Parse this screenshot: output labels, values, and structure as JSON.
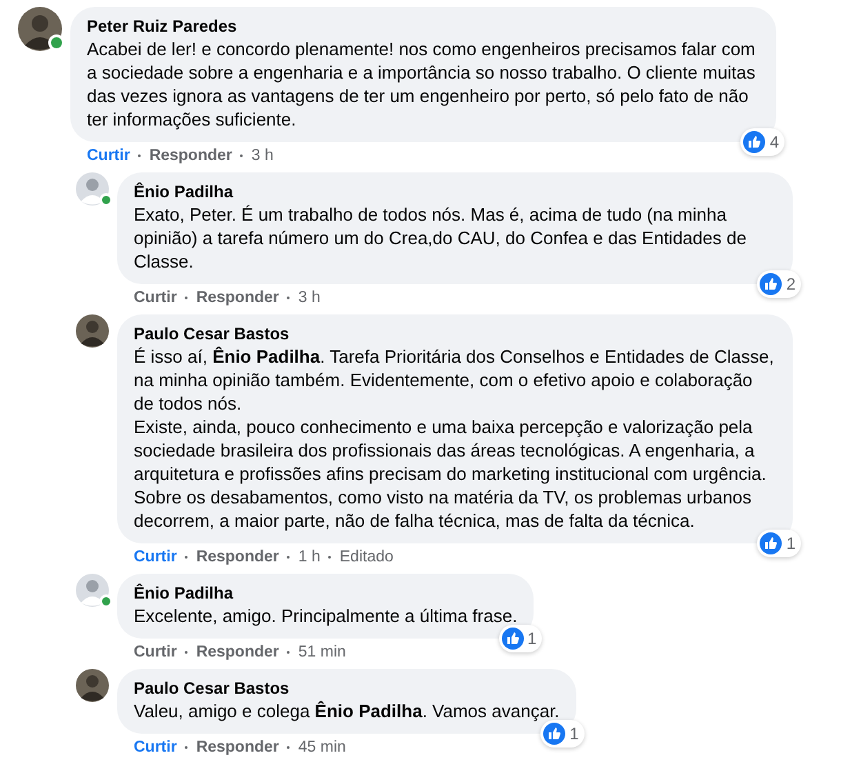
{
  "comments": [
    {
      "author": "Peter Ruiz Paredes",
      "online": true,
      "text": "Acabei de ler! e concordo plenamente! nos como engenheiros precisamos falar com a sociedade sobre a engenharia e a importância so nosso trabalho. O cliente muitas das vezes ignora as vantagens de ter um engenheiro por perto, só pelo fato de não ter informações suficiente.",
      "like_label": "Curtir",
      "liked": true,
      "reply_label": "Responder",
      "time": "3 h",
      "reactions": "4",
      "children": [
        {
          "author": "Ênio Padilha",
          "online": true,
          "text": "Exato, Peter. É um trabalho de todos nós. Mas é, acima de tudo (na minha opinião) a tarefa número um do Crea,do CAU, do Confea e das Entidades de Classe.",
          "like_label": "Curtir",
          "liked": false,
          "reply_label": "Responder",
          "time": "3 h",
          "reactions": "2"
        },
        {
          "author": "Paulo Cesar Bastos",
          "online": false,
          "text": "É isso aí, **Ênio Padilha**. Tarefa Prioritária dos Conselhos e Entidades de Classe, na minha opinião também. Evidentemente, com o efetivo apoio e colaboração de todos nós.\nExiste, ainda, pouco conhecimento e uma baixa percepção e valorização pela sociedade brasileira dos profissionais das áreas tecnológicas. A engenharia, a arquitetura e profissões afins precisam do marketing institucional com urgência.\nSobre os desabamentos, como visto na matéria da TV, os problemas urbanos decorrem, a maior parte, não de falha técnica, mas de falta da técnica.",
          "like_label": "Curtir",
          "liked": true,
          "reply_label": "Responder",
          "time": "1 h",
          "edited": "Editado",
          "reactions": "1"
        },
        {
          "author": "Ênio Padilha",
          "online": true,
          "text": "Excelente, amigo. Principalmente a última frase.",
          "like_label": "Curtir",
          "liked": false,
          "reply_label": "Responder",
          "time": "51 min",
          "reactions": "1"
        },
        {
          "author": "Paulo Cesar Bastos",
          "online": false,
          "text": "Valeu, amigo e colega **Ênio Padilha**. Vamos avançar.",
          "like_label": "Curtir",
          "liked": true,
          "reply_label": "Responder",
          "time": "45 min",
          "reactions": "1"
        }
      ]
    }
  ]
}
